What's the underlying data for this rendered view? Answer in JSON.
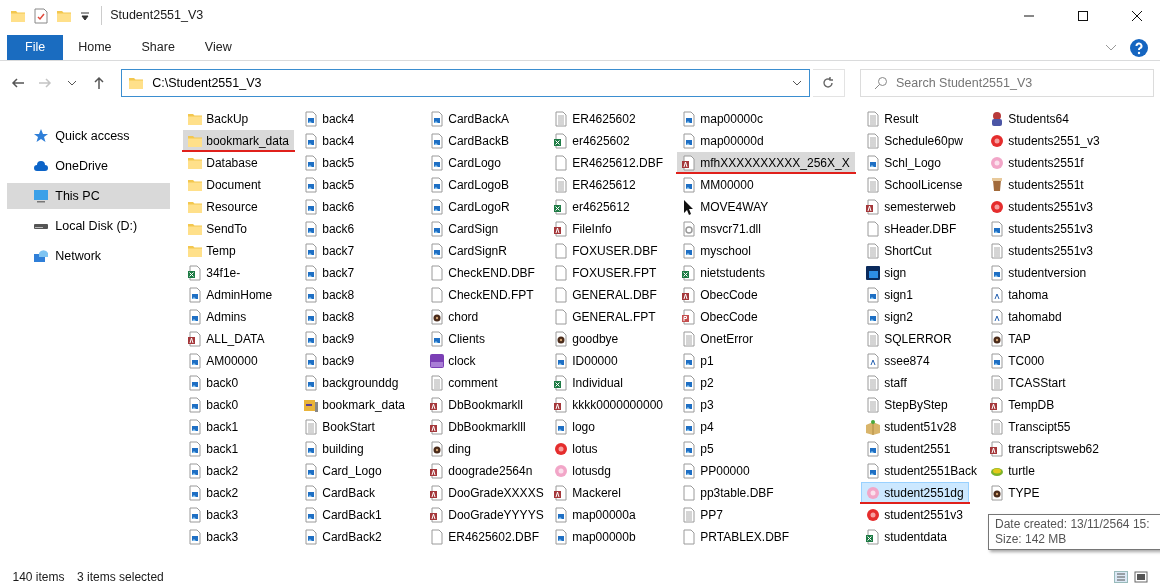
{
  "window": {
    "title": "Student2551_V3"
  },
  "ribbon_tabs": [
    {
      "label": "File",
      "selected": true
    },
    {
      "label": "Home",
      "selected": false
    },
    {
      "label": "Share",
      "selected": false
    },
    {
      "label": "View",
      "selected": false
    }
  ],
  "nav_buttons": [
    {
      "kind": "back",
      "disabled": false
    },
    {
      "kind": "forward",
      "disabled": true
    },
    {
      "kind": "recent",
      "disabled": false
    },
    {
      "kind": "up",
      "disabled": false
    }
  ],
  "address": {
    "value": "C:\\Student2551_V3"
  },
  "search": {
    "placeholder": "Search Student2551_V3"
  },
  "sidebar": {
    "items": [
      {
        "label": "Quick access",
        "kind": "star",
        "selected": false
      },
      {
        "label": "OneDrive",
        "kind": "cloud",
        "selected": false
      },
      {
        "label": "This PC",
        "kind": "pc",
        "selected": true
      },
      {
        "label": "Local Disk (D:)",
        "kind": "disk",
        "selected": false
      },
      {
        "label": "Network",
        "kind": "network",
        "selected": false
      }
    ]
  },
  "files": [
    {
      "name": "BackUp",
      "kind": "folder",
      "selected": false,
      "hovered": false,
      "annotated": false
    },
    {
      "name": "bookmark_data",
      "kind": "folder",
      "selected": true,
      "hovered": false,
      "annotated": true
    },
    {
      "name": "Database",
      "kind": "folder",
      "selected": false,
      "hovered": false,
      "annotated": false
    },
    {
      "name": "Document",
      "kind": "folder",
      "selected": false,
      "hovered": false,
      "annotated": false
    },
    {
      "name": "Resource",
      "kind": "folder",
      "selected": false,
      "hovered": false,
      "annotated": false
    },
    {
      "name": "SendTo",
      "kind": "folder",
      "selected": false,
      "hovered": false,
      "annotated": false
    },
    {
      "name": "Temp",
      "kind": "folder",
      "selected": false,
      "hovered": false,
      "annotated": false
    },
    {
      "name": "34f1e-",
      "kind": "excel",
      "selected": false,
      "hovered": false,
      "annotated": false
    },
    {
      "name": "AdminHome",
      "kind": "image",
      "selected": false,
      "hovered": false,
      "annotated": false
    },
    {
      "name": "Admins",
      "kind": "image",
      "selected": false,
      "hovered": false,
      "annotated": false
    },
    {
      "name": "ALL_DATA",
      "kind": "access",
      "selected": false,
      "hovered": false,
      "annotated": false
    },
    {
      "name": "AM00000",
      "kind": "image",
      "selected": false,
      "hovered": false,
      "annotated": false
    },
    {
      "name": "back0",
      "kind": "image",
      "selected": false,
      "hovered": false,
      "annotated": false
    },
    {
      "name": "back0",
      "kind": "image",
      "selected": false,
      "hovered": false,
      "annotated": false
    },
    {
      "name": "back1",
      "kind": "image",
      "selected": false,
      "hovered": false,
      "annotated": false
    },
    {
      "name": "back1",
      "kind": "image",
      "selected": false,
      "hovered": false,
      "annotated": false
    },
    {
      "name": "back2",
      "kind": "image",
      "selected": false,
      "hovered": false,
      "annotated": false
    },
    {
      "name": "back2",
      "kind": "image",
      "selected": false,
      "hovered": false,
      "annotated": false
    },
    {
      "name": "back3",
      "kind": "image",
      "selected": false,
      "hovered": false,
      "annotated": false
    },
    {
      "name": "back3",
      "kind": "image",
      "selected": false,
      "hovered": false,
      "annotated": false
    },
    {
      "name": "back4",
      "kind": "image",
      "selected": false,
      "hovered": false,
      "annotated": false
    },
    {
      "name": "back4",
      "kind": "image",
      "selected": false,
      "hovered": false,
      "annotated": false
    },
    {
      "name": "back5",
      "kind": "image",
      "selected": false,
      "hovered": false,
      "annotated": false
    },
    {
      "name": "back5",
      "kind": "image",
      "selected": false,
      "hovered": false,
      "annotated": false
    },
    {
      "name": "back6",
      "kind": "image",
      "selected": false,
      "hovered": false,
      "annotated": false
    },
    {
      "name": "back6",
      "kind": "image",
      "selected": false,
      "hovered": false,
      "annotated": false
    },
    {
      "name": "back7",
      "kind": "image",
      "selected": false,
      "hovered": false,
      "annotated": false
    },
    {
      "name": "back7",
      "kind": "image",
      "selected": false,
      "hovered": false,
      "annotated": false
    },
    {
      "name": "back8",
      "kind": "image",
      "selected": false,
      "hovered": false,
      "annotated": false
    },
    {
      "name": "back8",
      "kind": "image",
      "selected": false,
      "hovered": false,
      "annotated": false
    },
    {
      "name": "back9",
      "kind": "image",
      "selected": false,
      "hovered": false,
      "annotated": false
    },
    {
      "name": "back9",
      "kind": "image",
      "selected": false,
      "hovered": false,
      "annotated": false
    },
    {
      "name": "backgrounddg",
      "kind": "image",
      "selected": false,
      "hovered": false,
      "annotated": false
    },
    {
      "name": "bookmark_data",
      "kind": "archive",
      "selected": false,
      "hovered": false,
      "annotated": false
    },
    {
      "name": "BookStart",
      "kind": "text",
      "selected": false,
      "hovered": false,
      "annotated": false
    },
    {
      "name": "building",
      "kind": "image",
      "selected": false,
      "hovered": false,
      "annotated": false
    },
    {
      "name": "Card_Logo",
      "kind": "image",
      "selected": false,
      "hovered": false,
      "annotated": false
    },
    {
      "name": "CardBack",
      "kind": "image",
      "selected": false,
      "hovered": false,
      "annotated": false
    },
    {
      "name": "CardBack1",
      "kind": "image",
      "selected": false,
      "hovered": false,
      "annotated": false
    },
    {
      "name": "CardBack2",
      "kind": "image",
      "selected": false,
      "hovered": false,
      "annotated": false
    },
    {
      "name": "CardBackA",
      "kind": "image",
      "selected": false,
      "hovered": false,
      "annotated": false
    },
    {
      "name": "CardBackB",
      "kind": "image",
      "selected": false,
      "hovered": false,
      "annotated": false
    },
    {
      "name": "CardLogo",
      "kind": "image",
      "selected": false,
      "hovered": false,
      "annotated": false
    },
    {
      "name": "CardLogoB",
      "kind": "image",
      "selected": false,
      "hovered": false,
      "annotated": false
    },
    {
      "name": "CardLogoR",
      "kind": "image",
      "selected": false,
      "hovered": false,
      "annotated": false
    },
    {
      "name": "CardSign",
      "kind": "image",
      "selected": false,
      "hovered": false,
      "annotated": false
    },
    {
      "name": "CardSignR",
      "kind": "image",
      "selected": false,
      "hovered": false,
      "annotated": false
    },
    {
      "name": "CheckEND.DBF",
      "kind": "blank",
      "selected": false,
      "hovered": false,
      "annotated": false
    },
    {
      "name": "CheckEND.FPT",
      "kind": "blank",
      "selected": false,
      "hovered": false,
      "annotated": false
    },
    {
      "name": "chord",
      "kind": "audio",
      "selected": false,
      "hovered": false,
      "annotated": false
    },
    {
      "name": "Clients",
      "kind": "image",
      "selected": false,
      "hovered": false,
      "annotated": false
    },
    {
      "name": "clock",
      "kind": "swf",
      "selected": false,
      "hovered": false,
      "annotated": false
    },
    {
      "name": "comment",
      "kind": "text",
      "selected": false,
      "hovered": false,
      "annotated": false
    },
    {
      "name": "DbBookmarkll",
      "kind": "access",
      "selected": false,
      "hovered": false,
      "annotated": false
    },
    {
      "name": "DbBookmarklll",
      "kind": "access",
      "selected": false,
      "hovered": false,
      "annotated": false
    },
    {
      "name": "ding",
      "kind": "audio",
      "selected": false,
      "hovered": false,
      "annotated": false
    },
    {
      "name": "doograde2564n",
      "kind": "access",
      "selected": false,
      "hovered": false,
      "annotated": false
    },
    {
      "name": "DooGradeXXXXS",
      "kind": "access",
      "selected": false,
      "hovered": false,
      "annotated": false
    },
    {
      "name": "DooGradeYYYYS",
      "kind": "access",
      "selected": false,
      "hovered": false,
      "annotated": false
    },
    {
      "name": "ER4625602.DBF",
      "kind": "blank",
      "selected": false,
      "hovered": false,
      "annotated": false
    },
    {
      "name": "ER4625602",
      "kind": "text",
      "selected": false,
      "hovered": false,
      "annotated": false
    },
    {
      "name": "er4625602",
      "kind": "excel",
      "selected": false,
      "hovered": false,
      "annotated": false
    },
    {
      "name": "ER4625612.DBF",
      "kind": "blank",
      "selected": false,
      "hovered": false,
      "annotated": false
    },
    {
      "name": "ER4625612",
      "kind": "text",
      "selected": false,
      "hovered": false,
      "annotated": false
    },
    {
      "name": "er4625612",
      "kind": "excel",
      "selected": false,
      "hovered": false,
      "annotated": false
    },
    {
      "name": "FileInfo",
      "kind": "access",
      "selected": false,
      "hovered": false,
      "annotated": false
    },
    {
      "name": "FOXUSER.DBF",
      "kind": "blank",
      "selected": false,
      "hovered": false,
      "annotated": false
    },
    {
      "name": "FOXUSER.FPT",
      "kind": "blank",
      "selected": false,
      "hovered": false,
      "annotated": false
    },
    {
      "name": "GENERAL.DBF",
      "kind": "blank",
      "selected": false,
      "hovered": false,
      "annotated": false
    },
    {
      "name": "GENERAL.FPT",
      "kind": "blank",
      "selected": false,
      "hovered": false,
      "annotated": false
    },
    {
      "name": "goodbye",
      "kind": "audio",
      "selected": false,
      "hovered": false,
      "annotated": false
    },
    {
      "name": "ID00000",
      "kind": "image",
      "selected": false,
      "hovered": false,
      "annotated": false
    },
    {
      "name": "Individual",
      "kind": "excel",
      "selected": false,
      "hovered": false,
      "annotated": false
    },
    {
      "name": "kkkk0000000000",
      "kind": "access",
      "selected": false,
      "hovered": false,
      "annotated": false
    },
    {
      "name": "logo",
      "kind": "image",
      "selected": false,
      "hovered": false,
      "annotated": false
    },
    {
      "name": "lotus",
      "kind": "flower",
      "selected": false,
      "hovered": false,
      "annotated": false
    },
    {
      "name": "lotusdg",
      "kind": "flower-pale",
      "selected": false,
      "hovered": false,
      "annotated": false
    },
    {
      "name": "Mackerel",
      "kind": "access",
      "selected": false,
      "hovered": false,
      "annotated": false
    },
    {
      "name": "map00000a",
      "kind": "image",
      "selected": false,
      "hovered": false,
      "annotated": false
    },
    {
      "name": "map00000b",
      "kind": "image",
      "selected": false,
      "hovered": false,
      "annotated": false
    },
    {
      "name": "map00000c",
      "kind": "image",
      "selected": false,
      "hovered": false,
      "annotated": false
    },
    {
      "name": "map00000d",
      "kind": "image",
      "selected": false,
      "hovered": false,
      "annotated": false
    },
    {
      "name": "mfhXXXXXXXXXX_256X_X",
      "kind": "access",
      "selected": true,
      "hovered": false,
      "annotated": true
    },
    {
      "name": "MM00000",
      "kind": "image",
      "selected": false,
      "hovered": false,
      "annotated": false
    },
    {
      "name": "MOVE4WAY",
      "kind": "cursor",
      "selected": false,
      "hovered": false,
      "annotated": false
    },
    {
      "name": "msvcr71.dll",
      "kind": "dll",
      "selected": false,
      "hovered": false,
      "annotated": false
    },
    {
      "name": "myschool",
      "kind": "image",
      "selected": false,
      "hovered": false,
      "annotated": false
    },
    {
      "name": "nietstudents",
      "kind": "excel",
      "selected": false,
      "hovered": false,
      "annotated": false
    },
    {
      "name": "ObecCode",
      "kind": "access",
      "selected": false,
      "hovered": false,
      "annotated": false
    },
    {
      "name": "ObecCode",
      "kind": "project",
      "selected": false,
      "hovered": false,
      "annotated": false
    },
    {
      "name": "OnetError",
      "kind": "text",
      "selected": false,
      "hovered": false,
      "annotated": false
    },
    {
      "name": "p1",
      "kind": "image",
      "selected": false,
      "hovered": false,
      "annotated": false
    },
    {
      "name": "p2",
      "kind": "image",
      "selected": false,
      "hovered": false,
      "annotated": false
    },
    {
      "name": "p3",
      "kind": "image",
      "selected": false,
      "hovered": false,
      "annotated": false
    },
    {
      "name": "p4",
      "kind": "image",
      "selected": false,
      "hovered": false,
      "annotated": false
    },
    {
      "name": "p5",
      "kind": "image",
      "selected": false,
      "hovered": false,
      "annotated": false
    },
    {
      "name": "PP00000",
      "kind": "image",
      "selected": false,
      "hovered": false,
      "annotated": false
    },
    {
      "name": "pp3table.DBF",
      "kind": "blank",
      "selected": false,
      "hovered": false,
      "annotated": false
    },
    {
      "name": "PP7",
      "kind": "text",
      "selected": false,
      "hovered": false,
      "annotated": false
    },
    {
      "name": "PRTABLEX.DBF",
      "kind": "blank",
      "selected": false,
      "hovered": false,
      "annotated": false
    },
    {
      "name": "Result",
      "kind": "text",
      "selected": false,
      "hovered": false,
      "annotated": false
    },
    {
      "name": "Schedule60pw",
      "kind": "text",
      "selected": false,
      "hovered": false,
      "annotated": false
    },
    {
      "name": "Schl_Logo",
      "kind": "image",
      "selected": false,
      "hovered": false,
      "annotated": false
    },
    {
      "name": "SchoolLicense",
      "kind": "text",
      "selected": false,
      "hovered": false,
      "annotated": false
    },
    {
      "name": "semesterweb",
      "kind": "access",
      "selected": false,
      "hovered": false,
      "annotated": false
    },
    {
      "name": "sHeader.DBF",
      "kind": "blank",
      "selected": false,
      "hovered": false,
      "annotated": false
    },
    {
      "name": "ShortCut",
      "kind": "text",
      "selected": false,
      "hovered": false,
      "annotated": false
    },
    {
      "name": "sign",
      "kind": "psd",
      "selected": false,
      "hovered": false,
      "annotated": false
    },
    {
      "name": "sign1",
      "kind": "image",
      "selected": false,
      "hovered": false,
      "annotated": false
    },
    {
      "name": "sign2",
      "kind": "image",
      "selected": false,
      "hovered": false,
      "annotated": false
    },
    {
      "name": "SQLERROR",
      "kind": "text",
      "selected": false,
      "hovered": false,
      "annotated": false
    },
    {
      "name": "ssee874",
      "kind": "font",
      "selected": false,
      "hovered": false,
      "annotated": false
    },
    {
      "name": "staff",
      "kind": "text",
      "selected": false,
      "hovered": false,
      "annotated": false
    },
    {
      "name": "StepByStep",
      "kind": "text",
      "selected": false,
      "hovered": false,
      "annotated": false
    },
    {
      "name": "student51v28",
      "kind": "package",
      "selected": false,
      "hovered": false,
      "annotated": false
    },
    {
      "name": "student2551",
      "kind": "image",
      "selected": false,
      "hovered": false,
      "annotated": false
    },
    {
      "name": "student2551Back",
      "kind": "image",
      "selected": false,
      "hovered": false,
      "annotated": false
    },
    {
      "name": "student2551dg",
      "kind": "flower-pale",
      "selected": true,
      "hovered": true,
      "annotated": true
    },
    {
      "name": "student2551v3",
      "kind": "flower",
      "selected": false,
      "hovered": false,
      "annotated": false
    },
    {
      "name": "studentdata",
      "kind": "excel",
      "selected": false,
      "hovered": false,
      "annotated": false
    },
    {
      "name": "Students64",
      "kind": "app",
      "selected": false,
      "hovered": false,
      "annotated": false
    },
    {
      "name": "students2551_v3",
      "kind": "flower",
      "selected": false,
      "hovered": false,
      "annotated": false
    },
    {
      "name": "students2551f",
      "kind": "flower-pale",
      "selected": false,
      "hovered": false,
      "annotated": false
    },
    {
      "name": "students2551t",
      "kind": "cup",
      "selected": false,
      "hovered": false,
      "annotated": false
    },
    {
      "name": "students2551v3",
      "kind": "flower",
      "selected": false,
      "hovered": false,
      "annotated": false
    },
    {
      "name": "students2551v3",
      "kind": "image",
      "selected": false,
      "hovered": false,
      "annotated": false
    },
    {
      "name": "students2551v3",
      "kind": "text",
      "selected": false,
      "hovered": false,
      "annotated": false
    },
    {
      "name": "studentversion",
      "kind": "image",
      "selected": false,
      "hovered": false,
      "annotated": false
    },
    {
      "name": "tahoma",
      "kind": "font",
      "selected": false,
      "hovered": false,
      "annotated": false
    },
    {
      "name": "tahomabd",
      "kind": "font",
      "selected": false,
      "hovered": false,
      "annotated": false
    },
    {
      "name": "TAP",
      "kind": "audio",
      "selected": false,
      "hovered": false,
      "annotated": false
    },
    {
      "name": "TC000",
      "kind": "image",
      "selected": false,
      "hovered": false,
      "annotated": false
    },
    {
      "name": "TCASStart",
      "kind": "text",
      "selected": false,
      "hovered": false,
      "annotated": false
    },
    {
      "name": "TempDB",
      "kind": "access",
      "selected": false,
      "hovered": false,
      "annotated": false
    },
    {
      "name": "Transcipt55",
      "kind": "text",
      "selected": false,
      "hovered": false,
      "annotated": false
    },
    {
      "name": "transcriptsweb62",
      "kind": "access",
      "selected": false,
      "hovered": false,
      "annotated": false
    },
    {
      "name": "turtle",
      "kind": "turtle",
      "selected": false,
      "hovered": false,
      "annotated": false
    },
    {
      "name": "TYPE",
      "kind": "audio",
      "selected": false,
      "hovered": false,
      "annotated": false
    }
  ],
  "tooltip": {
    "lines": [
      "Date created: 13/11/2564 15:",
      "Size: 142 MB"
    ]
  },
  "status_bar": {
    "item_count": "140 items",
    "selection": "3 items selected"
  }
}
